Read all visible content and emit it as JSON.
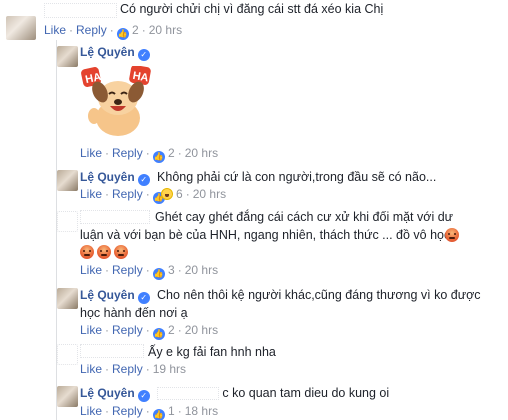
{
  "thread": {
    "top_comment": {
      "text": "Có người chửi chị vì đăng cái stt đá xéo kia Chị",
      "like": "Like",
      "reply": "Reply",
      "likes": "2",
      "time": "20 hrs"
    },
    "replies": [
      {
        "author": "Lệ Quyên",
        "sticker_text": "HA HA",
        "like": "Like",
        "reply": "Reply",
        "likes": "2",
        "time": "20 hrs"
      },
      {
        "author": "Lệ Quyên",
        "text": "Không phải cứ là con người,trong đầu sẽ có não...",
        "like": "Like",
        "reply": "Reply",
        "reactions": "6",
        "time": "20 hrs"
      },
      {
        "text_line1": "Ghét cay ghét đắng cái cách cư xử khi đối mặt với dư",
        "text_line2": "luận và với bạn bè của HNH, ngang nhiên, thách thức ... đồ vô học",
        "like": "Like",
        "reply": "Reply",
        "likes": "3",
        "time": "20 hrs"
      },
      {
        "author": "Lệ Quyên",
        "text_line1": "Cho nên thôi kệ người khác,cũng đáng thương vì ko được",
        "text_line2": "học hành đến nơi ạ",
        "like": "Like",
        "reply": "Reply",
        "likes": "2",
        "time": "20 hrs"
      },
      {
        "text": "Ấy e kg fải fan hnh nha",
        "like": "Like",
        "reply": "Reply",
        "time": "19 hrs"
      },
      {
        "author": "Lệ Quyên",
        "text": "c ko quan tam dieu do kung oi",
        "like": "Like",
        "reply": "Reply",
        "likes": "1",
        "time": "18 hrs"
      }
    ]
  },
  "colors": {
    "link": "#365899",
    "meta": "#90949c",
    "like": "#4080ff"
  }
}
